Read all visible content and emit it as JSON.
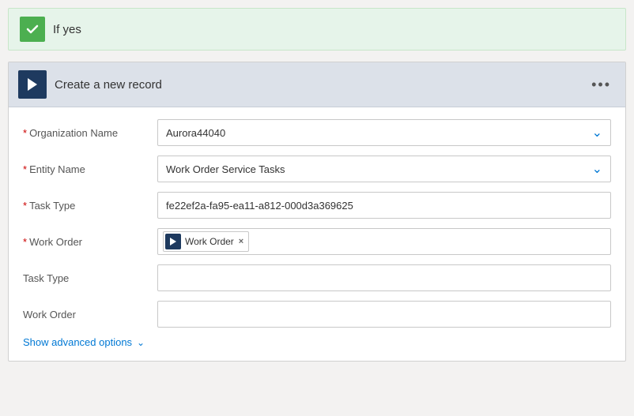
{
  "ifyes": {
    "label": "If yes"
  },
  "card": {
    "title": "Create a new record",
    "more_options_label": "•••"
  },
  "form": {
    "fields": [
      {
        "id": "org-name",
        "label": "Organization Name",
        "required": true,
        "type": "dropdown",
        "value": "Aurora44040"
      },
      {
        "id": "entity-name",
        "label": "Entity Name",
        "required": true,
        "type": "dropdown",
        "value": "Work Order Service Tasks"
      },
      {
        "id": "task-type-required",
        "label": "Task Type",
        "required": true,
        "type": "text",
        "value": "fe22ef2a-fa95-ea11-a812-000d3a369625"
      },
      {
        "id": "work-order-required",
        "label": "Work Order",
        "required": true,
        "type": "tag",
        "tag_label": "Work Order"
      },
      {
        "id": "task-type",
        "label": "Task Type",
        "required": false,
        "type": "text",
        "value": ""
      },
      {
        "id": "work-order",
        "label": "Work Order",
        "required": false,
        "type": "text",
        "value": ""
      }
    ],
    "advanced_options_label": "Show advanced options"
  }
}
